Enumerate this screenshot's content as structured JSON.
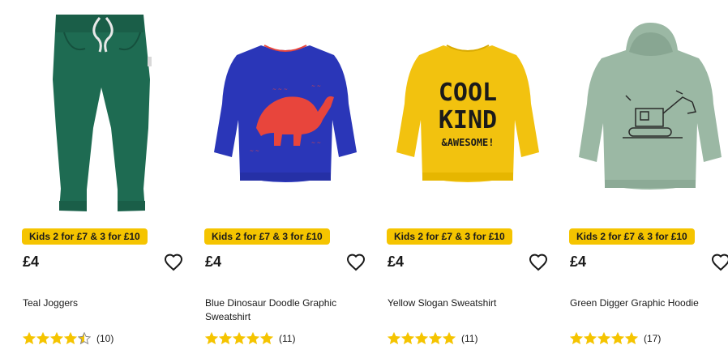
{
  "colors": {
    "promo_bg": "#f5c400",
    "star": "#f5c400",
    "text": "#1a1a1a"
  },
  "products": [
    {
      "image_icon": "teal-joggers-image",
      "promo": "Kids 2 for £7 & 3 for £10",
      "price": "£4",
      "name": "Teal Joggers",
      "rating": 4.5,
      "review_count": "(10)"
    },
    {
      "image_icon": "blue-dinosaur-sweatshirt-image",
      "promo": "Kids 2 for £7 & 3 for £10",
      "price": "£4",
      "name": "Blue Dinosaur Doodle Graphic Sweatshirt",
      "rating": 5,
      "review_count": "(11)"
    },
    {
      "image_icon": "yellow-slogan-sweatshirt-image",
      "promo": "Kids 2 for £7 & 3 for £10",
      "price": "£4",
      "name": "Yellow Slogan Sweatshirt",
      "image_text": [
        "COOL",
        "KIND",
        "&AWESOME!"
      ],
      "rating": 5,
      "review_count": "(11)"
    },
    {
      "image_icon": "green-digger-hoodie-image",
      "promo": "Kids 2 for £7 & 3 for £10",
      "price": "£4",
      "name": "Green Digger Graphic Hoodie",
      "rating": 5,
      "review_count": "(17)"
    }
  ]
}
